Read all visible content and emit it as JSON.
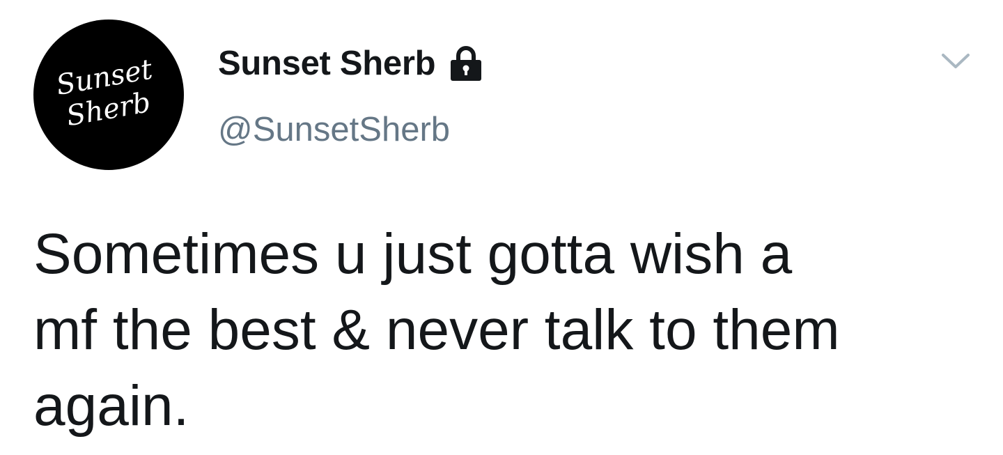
{
  "tweet": {
    "avatar_logo_text": [
      "Sunset",
      "Sherb"
    ],
    "display_name": "Sunset Sherb",
    "protected_icon": "lock-icon",
    "handle": "@SunsetSherb",
    "menu_icon": "chevron-down-icon",
    "text_lines": [
      "Sometimes u just gotta wish a",
      "mf the best & never talk to them",
      "again."
    ]
  },
  "colors": {
    "text_primary": "#14171a",
    "text_secondary": "#657786",
    "avatar_background": "#000000",
    "caret": "#aab8c2"
  }
}
